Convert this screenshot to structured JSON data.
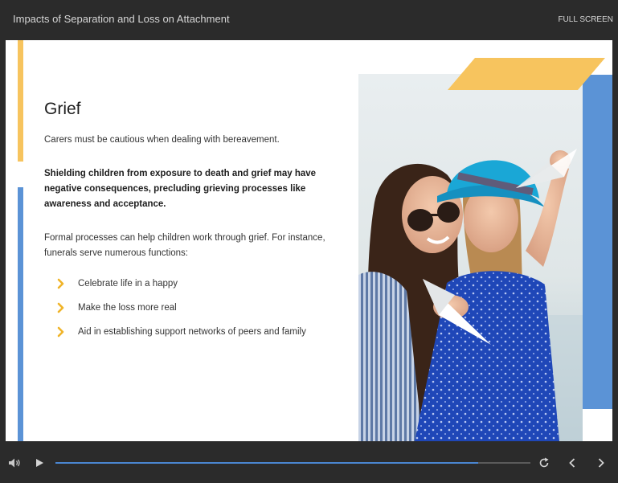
{
  "window": {
    "title": "Impacts of Separation and Loss on Attachment",
    "fullscreen_label": "FULL SCREEN"
  },
  "slide": {
    "heading": "Grief",
    "paragraph1": "Carers must be cautious when dealing with bereavement.",
    "paragraph2": "Shielding children from exposure to death and grief may have negative consequences, precluding grieving processes like awareness and acceptance.",
    "paragraph3": "Formal processes can help children work through grief. For instance, funerals serve numerous functions:",
    "bullets": [
      "Celebrate life in a happy",
      "Make the loss more real",
      "Aid in establishing support networks of peers and family"
    ],
    "bullet_icon": "chevron-right-icon",
    "photo_icon": "photo-mother-daughter-paper-plane"
  },
  "player": {
    "progress": 0.89,
    "icons": {
      "volume": "volume-icon",
      "play": "play-icon",
      "replay": "replay-icon",
      "previous": "chevron-left-icon",
      "next": "chevron-right-icon"
    }
  },
  "colors": {
    "accent_yellow": "#f7c45e",
    "accent_blue": "#5b93d6",
    "progress_blue": "#4a86d1",
    "player_bg": "#2b2b2b"
  }
}
